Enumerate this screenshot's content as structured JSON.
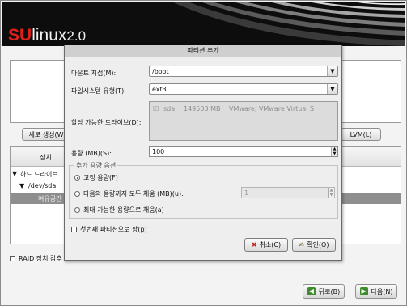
{
  "header": {
    "logo_su": "SU",
    "logo_linux": "linux",
    "logo_version": "2.0"
  },
  "background": {
    "new_button": "새로 생성(",
    "new_button_key": "W",
    "lvm_button": "LVM(L)",
    "tree_header": "장치",
    "tree_items": [
      "하드 드라이브",
      "/dev/sda",
      "여유공간"
    ],
    "raid_label": "RAID 장치 감추",
    "back_button": "뒤로(B)",
    "next_button": "다음(N)"
  },
  "dialog": {
    "title": "파티션 추가",
    "mount_label": "마운트 지점(M):",
    "mount_value": "/boot",
    "fs_label": "파일시스템 유형(T):",
    "fs_value": "ext3",
    "drives_label": "할당 가능한 드라이브(D):",
    "drives": [
      {
        "name": "sda",
        "size": "149503 MB",
        "model": "VMware, VMware Virtual S",
        "checked": true
      }
    ],
    "size_label": "용량 (MB)(S):",
    "size_value": "100",
    "options_label": "추가 용량 옵션",
    "options": [
      {
        "label": "고정 용량(F)",
        "selected": true
      },
      {
        "label": "다음의 용량까지 모두 채움 (MB)(u):",
        "selected": false
      },
      {
        "label": "최대 가능한 용량으로 채움(a)",
        "selected": false
      }
    ],
    "fill_to_value": "1",
    "primary_label": "첫번째 파티션으로 함(p)",
    "cancel_button": "취소(C)",
    "ok_button": "확인(O)"
  }
}
